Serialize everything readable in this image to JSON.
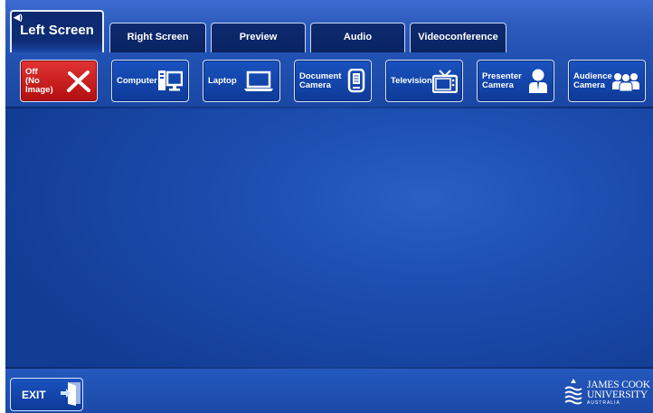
{
  "tabs": [
    {
      "label": "Left Screen",
      "active": true
    },
    {
      "label": "Right Screen",
      "active": false
    },
    {
      "label": "Preview",
      "active": false
    },
    {
      "label": "Audio",
      "active": false
    },
    {
      "label": "Videoconference",
      "active": false
    }
  ],
  "sources": [
    {
      "label": "Off\n(No Image)",
      "icon": "x-cross-icon",
      "color": "#c81e1e"
    },
    {
      "label": "Computer",
      "icon": "computer-icon"
    },
    {
      "label": "Laptop",
      "icon": "laptop-icon"
    },
    {
      "label": "Document\nCamera",
      "icon": "document-camera-icon"
    },
    {
      "label": "Television",
      "icon": "television-icon"
    },
    {
      "label": "Presenter\nCamera",
      "icon": "presenter-icon"
    },
    {
      "label": "Audience\nCamera",
      "icon": "audience-icon"
    }
  ],
  "footer": {
    "exit_label": "EXIT",
    "logo_line1": "JAMES COOK",
    "logo_line2": "UNIVERSITY",
    "logo_line3": "AUSTRALIA"
  },
  "colors": {
    "accent": "#1b4cae",
    "off_button": "#c81e1e",
    "tab_dark": "#0c2868"
  }
}
